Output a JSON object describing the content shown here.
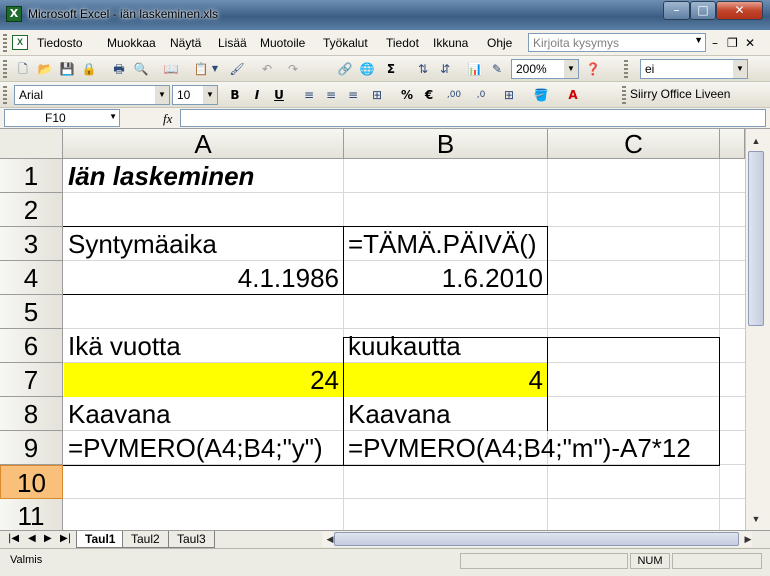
{
  "window": {
    "title": "Microsoft Excel - iän laskeminen.xls",
    "min": "–",
    "max": "□",
    "close": "✕"
  },
  "menu": {
    "items": [
      "Tiedosto",
      "Muokkaa",
      "Näytä",
      "Lisää",
      "Muotoile",
      "Työkalut",
      "Tiedot",
      "Ikkuna",
      "Ohje"
    ],
    "help_placeholder": "Kirjoita kysymys"
  },
  "toolbar": {
    "zoom": "200%",
    "style_box": "ei",
    "font": "Arial",
    "font_size": "10",
    "bold": "B",
    "italic": "I",
    "underline": "U",
    "percent": "%",
    "euro": "€",
    "inc_dec": ",00",
    "dec_dec": ",0",
    "sum": "Σ",
    "office_link": "Siirry Office Liveen"
  },
  "formula_bar": {
    "name_box": "F10",
    "fx": "fx",
    "value": ""
  },
  "columns": [
    "A",
    "B",
    "C"
  ],
  "rows": [
    "1",
    "2",
    "3",
    "4",
    "5",
    "6",
    "7",
    "8",
    "9",
    "10",
    "11"
  ],
  "cells": {
    "A1": "Iän laskeminen",
    "A3": "Syntymäaika",
    "B3": "=TÄMÄ.PÄIVÄ()",
    "A4": "4.1.1986",
    "B4": "1.6.2010",
    "A6": "Ikä vuotta",
    "B6": "kuukautta",
    "A7": "24",
    "B7": "4",
    "A8": "Kaavana",
    "B8": "Kaavana",
    "A9": "=PVMERO(A4;B4;\"y\")",
    "B9": "=PVMERO(A4;B4;\"m\")-A7*12"
  },
  "sheets": [
    "Taul1",
    "Taul2",
    "Taul3"
  ],
  "status": {
    "text": "Valmis",
    "num": "NUM"
  },
  "colors": {
    "highlight": "#ffff00",
    "active_row": "#f8c07a",
    "title_bar": "#46688e"
  }
}
